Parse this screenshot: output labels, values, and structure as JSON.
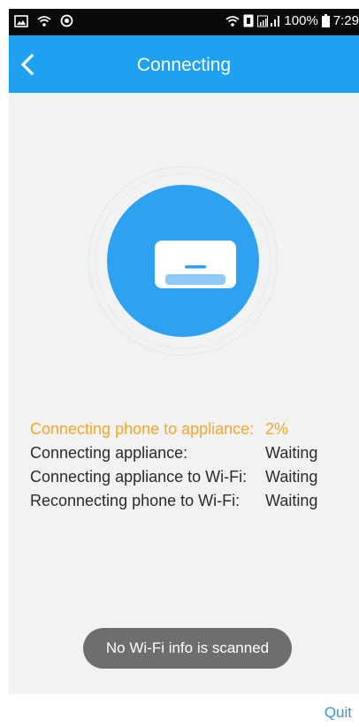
{
  "status_bar": {
    "battery": "100%",
    "time": "7:29",
    "icons": [
      "image-icon",
      "wifi-icon",
      "sync-icon",
      "wifi-icon",
      "sim-icon",
      "signal-icon",
      "battery-icon"
    ]
  },
  "header": {
    "title": "Connecting",
    "back_icon": "chevron-left-icon",
    "background": "#1ea1f1"
  },
  "device": {
    "icon": "air-conditioner-icon",
    "circle_color": "#2ea1f0"
  },
  "steps": [
    {
      "label": "Connecting phone to appliance:",
      "status": "2%",
      "color": "#f4a62a"
    },
    {
      "label": "Connecting appliance:",
      "status": "Waiting"
    },
    {
      "label": "Connecting appliance to Wi-Fi:",
      "status": "Waiting"
    },
    {
      "label": "Reconnecting phone to Wi-Fi:",
      "status": "Waiting"
    }
  ],
  "toast": {
    "message": "No Wi-Fi info is scanned"
  },
  "footer": {
    "quit_label": "Quit"
  }
}
